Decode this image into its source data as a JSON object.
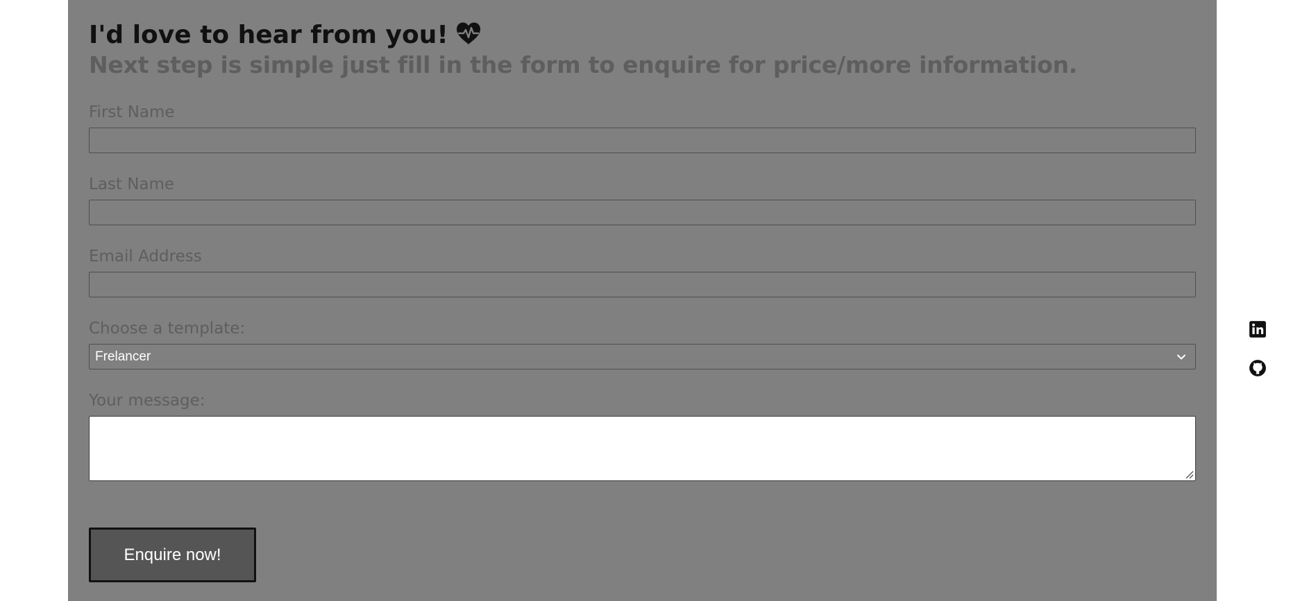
{
  "form": {
    "heading": "I'd love to hear from you!",
    "heading_icon": "heart-pulse-icon",
    "subheading": "Next step is simple just fill in the form to enquire for price/more information.",
    "first_name": {
      "label": "First Name",
      "value": ""
    },
    "last_name": {
      "label": "Last Name",
      "value": ""
    },
    "email": {
      "label": "Email Address",
      "value": ""
    },
    "template": {
      "label": "Choose a template:",
      "selected": "Frelancer"
    },
    "message": {
      "label": "Your message:",
      "value": ""
    },
    "submit_label": "Enquire now!"
  },
  "social_links": [
    {
      "icon": "linkedin-icon"
    },
    {
      "icon": "github-icon"
    }
  ],
  "colors": {
    "panel_background": "#808080",
    "page_background": "#ffffff",
    "heading": "#111111",
    "muted_text": "#5e5e5e",
    "button_background": "#555555"
  }
}
